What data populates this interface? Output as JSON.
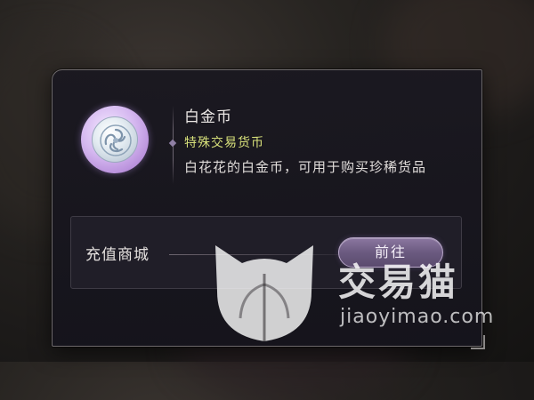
{
  "item": {
    "name": "白金币",
    "type": "特殊交易货币",
    "description": "白花花的白金币，可用于购买珍稀货品",
    "icon": "platinum-coin-icon"
  },
  "shop": {
    "label": "充值商城",
    "button_label": "前往"
  },
  "watermark": {
    "brand": "交易猫",
    "url": "jiaoyimao.com",
    "icon": "cat-logo-icon"
  },
  "colors": {
    "item_type": "#d7e07a",
    "button": "#7b689a",
    "panel_bg": "#1a1820"
  }
}
